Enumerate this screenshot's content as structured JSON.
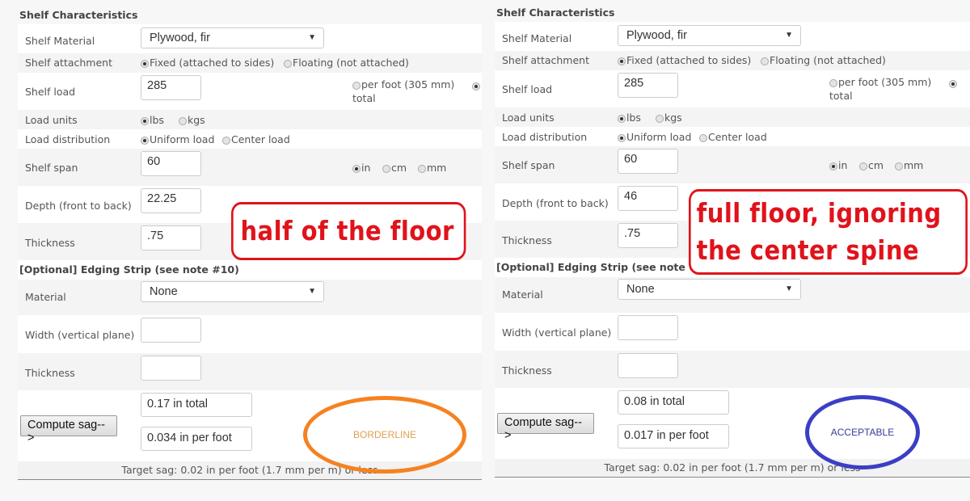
{
  "colors": {
    "annotation_red": "#e0131b",
    "borderline_orange": "#f58220",
    "borderline_text": "#e0a050",
    "acceptable_blue": "#3a3fc4",
    "acceptable_text": "#3a3a9a"
  },
  "panels": [
    {
      "section_title": "Shelf Characteristics",
      "shelf_material": {
        "label": "Shelf Material",
        "value": "Plywood, fir",
        "arrow": "▼"
      },
      "shelf_attachment": {
        "label": "Shelf attachment",
        "options": [
          {
            "label": "Fixed (attached to sides)",
            "selected": true
          },
          {
            "label": "Floating (not attached)",
            "selected": false
          }
        ]
      },
      "shelf_load": {
        "label": "Shelf load",
        "value": "285",
        "options": [
          {
            "label": "per foot (305 mm)",
            "selected": false
          },
          {
            "label": "total",
            "selected": true
          }
        ]
      },
      "load_units": {
        "label": "Load units",
        "options": [
          {
            "label": "lbs",
            "selected": true
          },
          {
            "label": "kgs",
            "selected": false
          }
        ]
      },
      "load_distribution": {
        "label": "Load distribution",
        "options": [
          {
            "label": "Uniform load",
            "selected": true
          },
          {
            "label": "Center load",
            "selected": false
          }
        ]
      },
      "shelf_span": {
        "label": "Shelf span",
        "value": "60",
        "options": [
          {
            "label": "in",
            "selected": true
          },
          {
            "label": "cm",
            "selected": false
          },
          {
            "label": "mm",
            "selected": false
          }
        ]
      },
      "depth": {
        "label": "Depth (front to back)",
        "value": "22.25"
      },
      "thickness": {
        "label": "Thickness",
        "value": ".75"
      },
      "edging_title": "[Optional]  Edging Strip (see note #10)",
      "edging_material": {
        "label": "Material",
        "value": "None",
        "arrow": "▼"
      },
      "edging_width": {
        "label": "Width (vertical plane)",
        "value": ""
      },
      "edging_thickness": {
        "label": "Thickness",
        "value": ""
      },
      "compute_button": "Compute sag-->",
      "sag_total": "0.17 in total",
      "sag_per_foot": "0.034 in per foot",
      "verdict": "BORDERLINE",
      "target_sag": "Target sag: 0.02 in per foot (1.7 mm per m) or less",
      "annotation": [
        "half of the floor"
      ]
    },
    {
      "section_title": "Shelf Characteristics",
      "shelf_material": {
        "label": "Shelf Material",
        "value": "Plywood, fir",
        "arrow": "▼"
      },
      "shelf_attachment": {
        "label": "Shelf attachment",
        "options": [
          {
            "label": "Fixed (attached to sides)",
            "selected": true
          },
          {
            "label": "Floating (not attached)",
            "selected": false
          }
        ]
      },
      "shelf_load": {
        "label": "Shelf load",
        "value": "285",
        "options": [
          {
            "label": "per foot (305 mm)",
            "selected": false
          },
          {
            "label": "total",
            "selected": true
          }
        ]
      },
      "load_units": {
        "label": "Load units",
        "options": [
          {
            "label": "lbs",
            "selected": true
          },
          {
            "label": "kgs",
            "selected": false
          }
        ]
      },
      "load_distribution": {
        "label": "Load distribution",
        "options": [
          {
            "label": "Uniform load",
            "selected": true
          },
          {
            "label": "Center load",
            "selected": false
          }
        ]
      },
      "shelf_span": {
        "label": "Shelf span",
        "value": "60",
        "options": [
          {
            "label": "in",
            "selected": true
          },
          {
            "label": "cm",
            "selected": false
          },
          {
            "label": "mm",
            "selected": false
          }
        ]
      },
      "depth": {
        "label": "Depth (front to back)",
        "value": "46"
      },
      "thickness": {
        "label": "Thickness",
        "value": ".75"
      },
      "edging_title": "[Optional]  Edging Strip (see note #10)",
      "edging_material": {
        "label": "Material",
        "value": "None",
        "arrow": "▼"
      },
      "edging_width": {
        "label": "Width (vertical plane)",
        "value": ""
      },
      "edging_thickness": {
        "label": "Thickness",
        "value": ""
      },
      "compute_button": "Compute sag-->",
      "sag_total": "0.08 in total",
      "sag_per_foot": "0.017 in per foot",
      "verdict": "ACCEPTABLE",
      "target_sag": "Target sag: 0.02 in per foot (1.7 mm per m) or less",
      "annotation": [
        "full floor, ignoring",
        "the center spine"
      ]
    }
  ]
}
